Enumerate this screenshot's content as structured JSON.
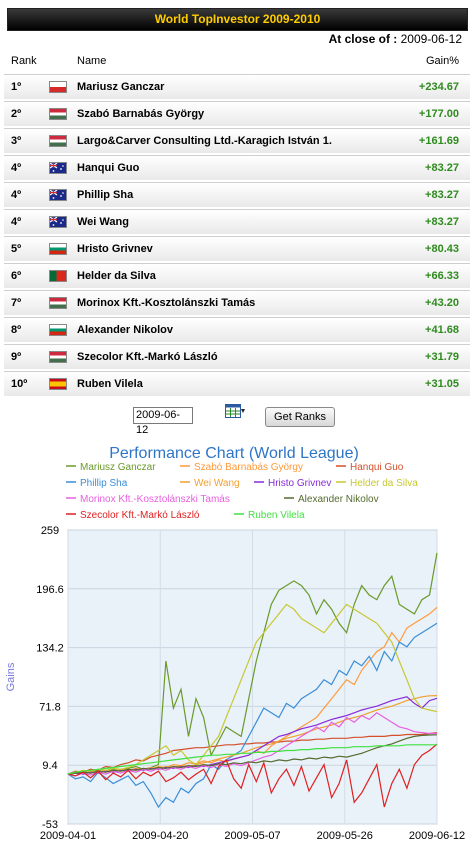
{
  "header": {
    "title": "World TopInvestor 2009-2010",
    "close_label": "At close of :",
    "close_date": "2009-06-12"
  },
  "columns": {
    "rank": "Rank",
    "name": "Name",
    "gain": "Gain%"
  },
  "rows": [
    {
      "rank": "1º",
      "name": "Mariusz Ganczar",
      "gain": "+234.67",
      "flag": "poland-flag"
    },
    {
      "rank": "2º",
      "name": "Szabó Barnabás György",
      "gain": "+177.00",
      "flag": "hungary-flag"
    },
    {
      "rank": "3º",
      "name": "Largo&Carver Consulting Ltd.-Karagich István 1.",
      "gain": "+161.69",
      "flag": "hungary-flag"
    },
    {
      "rank": "4º",
      "name": "Hanqui Guo",
      "gain": "+83.27",
      "flag": "australia-flag"
    },
    {
      "rank": "4º",
      "name": "Phillip Sha",
      "gain": "+83.27",
      "flag": "australia-flag"
    },
    {
      "rank": "4º",
      "name": "Wei Wang",
      "gain": "+83.27",
      "flag": "australia-flag"
    },
    {
      "rank": "5º",
      "name": "Hristo Grivnev",
      "gain": "+80.43",
      "flag": "bulgaria-flag"
    },
    {
      "rank": "6º",
      "name": "Helder da Silva",
      "gain": "+66.33",
      "flag": "portugal-flag"
    },
    {
      "rank": "7º",
      "name": "Morinox Kft.-Kosztolánszki Tamás",
      "gain": "+43.20",
      "flag": "hungary-flag"
    },
    {
      "rank": "8º",
      "name": "Alexander Nikolov",
      "gain": "+41.68",
      "flag": "bulgaria-flag"
    },
    {
      "rank": "9º",
      "name": "Szecolor Kft.-Markó László",
      "gain": "+31.79",
      "flag": "hungary-flag"
    },
    {
      "rank": "10º",
      "name": "Ruben Vilela",
      "gain": "+31.05",
      "flag": "spain-flag"
    }
  ],
  "controls": {
    "date_value": "2009-06-12",
    "button_label": "Get Ranks",
    "calendar_icon": "calendar-icon"
  },
  "colors": {
    "gain_text": "#2e8b1e",
    "title_text": "#ffcc00",
    "chart_title": "#2e75c7"
  },
  "chart_data": {
    "type": "line",
    "title": "Performance Chart (World League)",
    "ylabel": "Gains",
    "ylim": [
      -53,
      259
    ],
    "yticks": [
      "259",
      "196.6",
      "134.2",
      "71.8",
      "9.4",
      "-53"
    ],
    "xticks": [
      "2009-04-01",
      "2009-04-20",
      "2009-05-07",
      "2009-05-26",
      "2009-06-12"
    ],
    "x_count": 50,
    "series": [
      {
        "name": "Mariusz Ganczar",
        "color": "#6a9a2a",
        "values": [
          0,
          2,
          1,
          3,
          4,
          2,
          5,
          3,
          6,
          8,
          5,
          7,
          10,
          120,
          70,
          90,
          40,
          80,
          60,
          20,
          35,
          50,
          45,
          40,
          80,
          120,
          150,
          180,
          195,
          200,
          205,
          200,
          190,
          170,
          185,
          175,
          160,
          150,
          180,
          200,
          190,
          185,
          200,
          210,
          180,
          175,
          170,
          185,
          190,
          234.67
        ]
      },
      {
        "name": "Szabó Barnabás György",
        "color": "#ff9a3c",
        "values": [
          0,
          1,
          2,
          1,
          3,
          2,
          4,
          3,
          5,
          4,
          6,
          5,
          8,
          7,
          10,
          9,
          12,
          11,
          14,
          12,
          15,
          13,
          16,
          18,
          20,
          25,
          22,
          30,
          35,
          40,
          45,
          50,
          55,
          60,
          70,
          80,
          90,
          100,
          95,
          110,
          120,
          130,
          135,
          150,
          140,
          155,
          160,
          165,
          170,
          177
        ]
      },
      {
        "name": "Hanqui Guo",
        "color": "#d4502a",
        "values": [
          0,
          3,
          2,
          5,
          4,
          8,
          7,
          10,
          12,
          15,
          14,
          18,
          20,
          22,
          25,
          26,
          27,
          28,
          28,
          29,
          30,
          31,
          31,
          32,
          32,
          33,
          33,
          34,
          34,
          35,
          35,
          36,
          36,
          37,
          37,
          38,
          38,
          38,
          39,
          39,
          40,
          40,
          40,
          41,
          41,
          42,
          42,
          42,
          43,
          44
        ]
      },
      {
        "name": "Phillip Sha",
        "color": "#3a8ed8",
        "values": [
          0,
          -5,
          -3,
          -8,
          2,
          -4,
          -10,
          -6,
          -2,
          -12,
          -8,
          -20,
          -35,
          -25,
          -30,
          -15,
          -20,
          -10,
          -5,
          10,
          5,
          15,
          20,
          25,
          40,
          55,
          70,
          65,
          60,
          75,
          70,
          80,
          85,
          90,
          100,
          95,
          110,
          105,
          120,
          115,
          125,
          110,
          130,
          120,
          140,
          135,
          145,
          150,
          155,
          160
        ]
      },
      {
        "name": "Wei Wang",
        "color": "#f0a030",
        "values": [
          0,
          2,
          1,
          3,
          2,
          4,
          3,
          5,
          4,
          6,
          5,
          7,
          6,
          8,
          7,
          9,
          8,
          10,
          12,
          14,
          16,
          18,
          20,
          22,
          25,
          28,
          30,
          32,
          35,
          38,
          40,
          42,
          45,
          48,
          50,
          52,
          55,
          58,
          60,
          62,
          65,
          68,
          70,
          72,
          75,
          78,
          80,
          82,
          83,
          83.27
        ]
      },
      {
        "name": "Hristo Grivnev",
        "color": "#8a2ad8",
        "values": [
          0,
          1,
          0,
          2,
          1,
          3,
          2,
          4,
          3,
          5,
          4,
          6,
          5,
          7,
          6,
          8,
          7,
          9,
          8,
          10,
          12,
          14,
          16,
          18,
          20,
          25,
          30,
          35,
          40,
          42,
          45,
          48,
          50,
          52,
          55,
          58,
          60,
          62,
          65,
          68,
          70,
          72,
          75,
          78,
          80,
          82,
          75,
          70,
          78,
          80.43
        ]
      },
      {
        "name": "Helder da Silva",
        "color": "#c8c830",
        "values": [
          0,
          2,
          4,
          3,
          5,
          4,
          6,
          5,
          7,
          10,
          15,
          20,
          25,
          30,
          20,
          25,
          15,
          10,
          20,
          30,
          40,
          60,
          80,
          100,
          120,
          140,
          150,
          160,
          170,
          180,
          175,
          165,
          160,
          155,
          150,
          160,
          170,
          180,
          175,
          170,
          165,
          160,
          150,
          140,
          120,
          100,
          80,
          70,
          68,
          66.33
        ]
      },
      {
        "name": "Morinox Kft.-Kosztolánszki Tamás",
        "color": "#e860e0",
        "values": [
          0,
          -2,
          1,
          -1,
          2,
          0,
          3,
          1,
          4,
          2,
          5,
          3,
          6,
          4,
          7,
          5,
          8,
          6,
          9,
          7,
          10,
          8,
          11,
          9,
          12,
          15,
          18,
          20,
          25,
          30,
          35,
          40,
          45,
          50,
          45,
          55,
          50,
          60,
          55,
          62,
          58,
          65,
          60,
          55,
          50,
          48,
          45,
          44,
          43,
          43.2
        ]
      },
      {
        "name": "Alexander Nikolov",
        "color": "#556b2f",
        "values": [
          0,
          1,
          2,
          1,
          3,
          2,
          4,
          3,
          5,
          4,
          6,
          5,
          7,
          6,
          8,
          7,
          9,
          8,
          10,
          9,
          11,
          10,
          12,
          11,
          13,
          12,
          14,
          13,
          15,
          14,
          16,
          15,
          17,
          16,
          18,
          17,
          19,
          18,
          20,
          22,
          25,
          28,
          30,
          32,
          35,
          38,
          40,
          41,
          41.5,
          41.68
        ]
      },
      {
        "name": "Szecolor Kft.-Markó László",
        "color": "#e02020",
        "values": [
          0,
          -2,
          2,
          -4,
          3,
          -6,
          1,
          -3,
          4,
          -5,
          2,
          -2,
          3,
          -8,
          -4,
          2,
          -6,
          0,
          5,
          -10,
          8,
          15,
          -5,
          -15,
          10,
          -8,
          12,
          -20,
          -5,
          5,
          -12,
          8,
          -18,
          -4,
          10,
          -25,
          -10,
          15,
          -30,
          -20,
          -5,
          10,
          -35,
          -10,
          5,
          -15,
          10,
          20,
          25,
          31.79
        ]
      },
      {
        "name": "Ruben Vilela",
        "color": "#40e040",
        "values": [
          0,
          2,
          3,
          4,
          5,
          6,
          7,
          8,
          9,
          10,
          11,
          12,
          13,
          14,
          15,
          16,
          17,
          18,
          19,
          20,
          20,
          21,
          21,
          22,
          22,
          23,
          23,
          24,
          24,
          25,
          25,
          26,
          26,
          27,
          27,
          28,
          28,
          28,
          29,
          29,
          29,
          30,
          30,
          30,
          30,
          31,
          31,
          31,
          31,
          31.05
        ]
      }
    ]
  }
}
